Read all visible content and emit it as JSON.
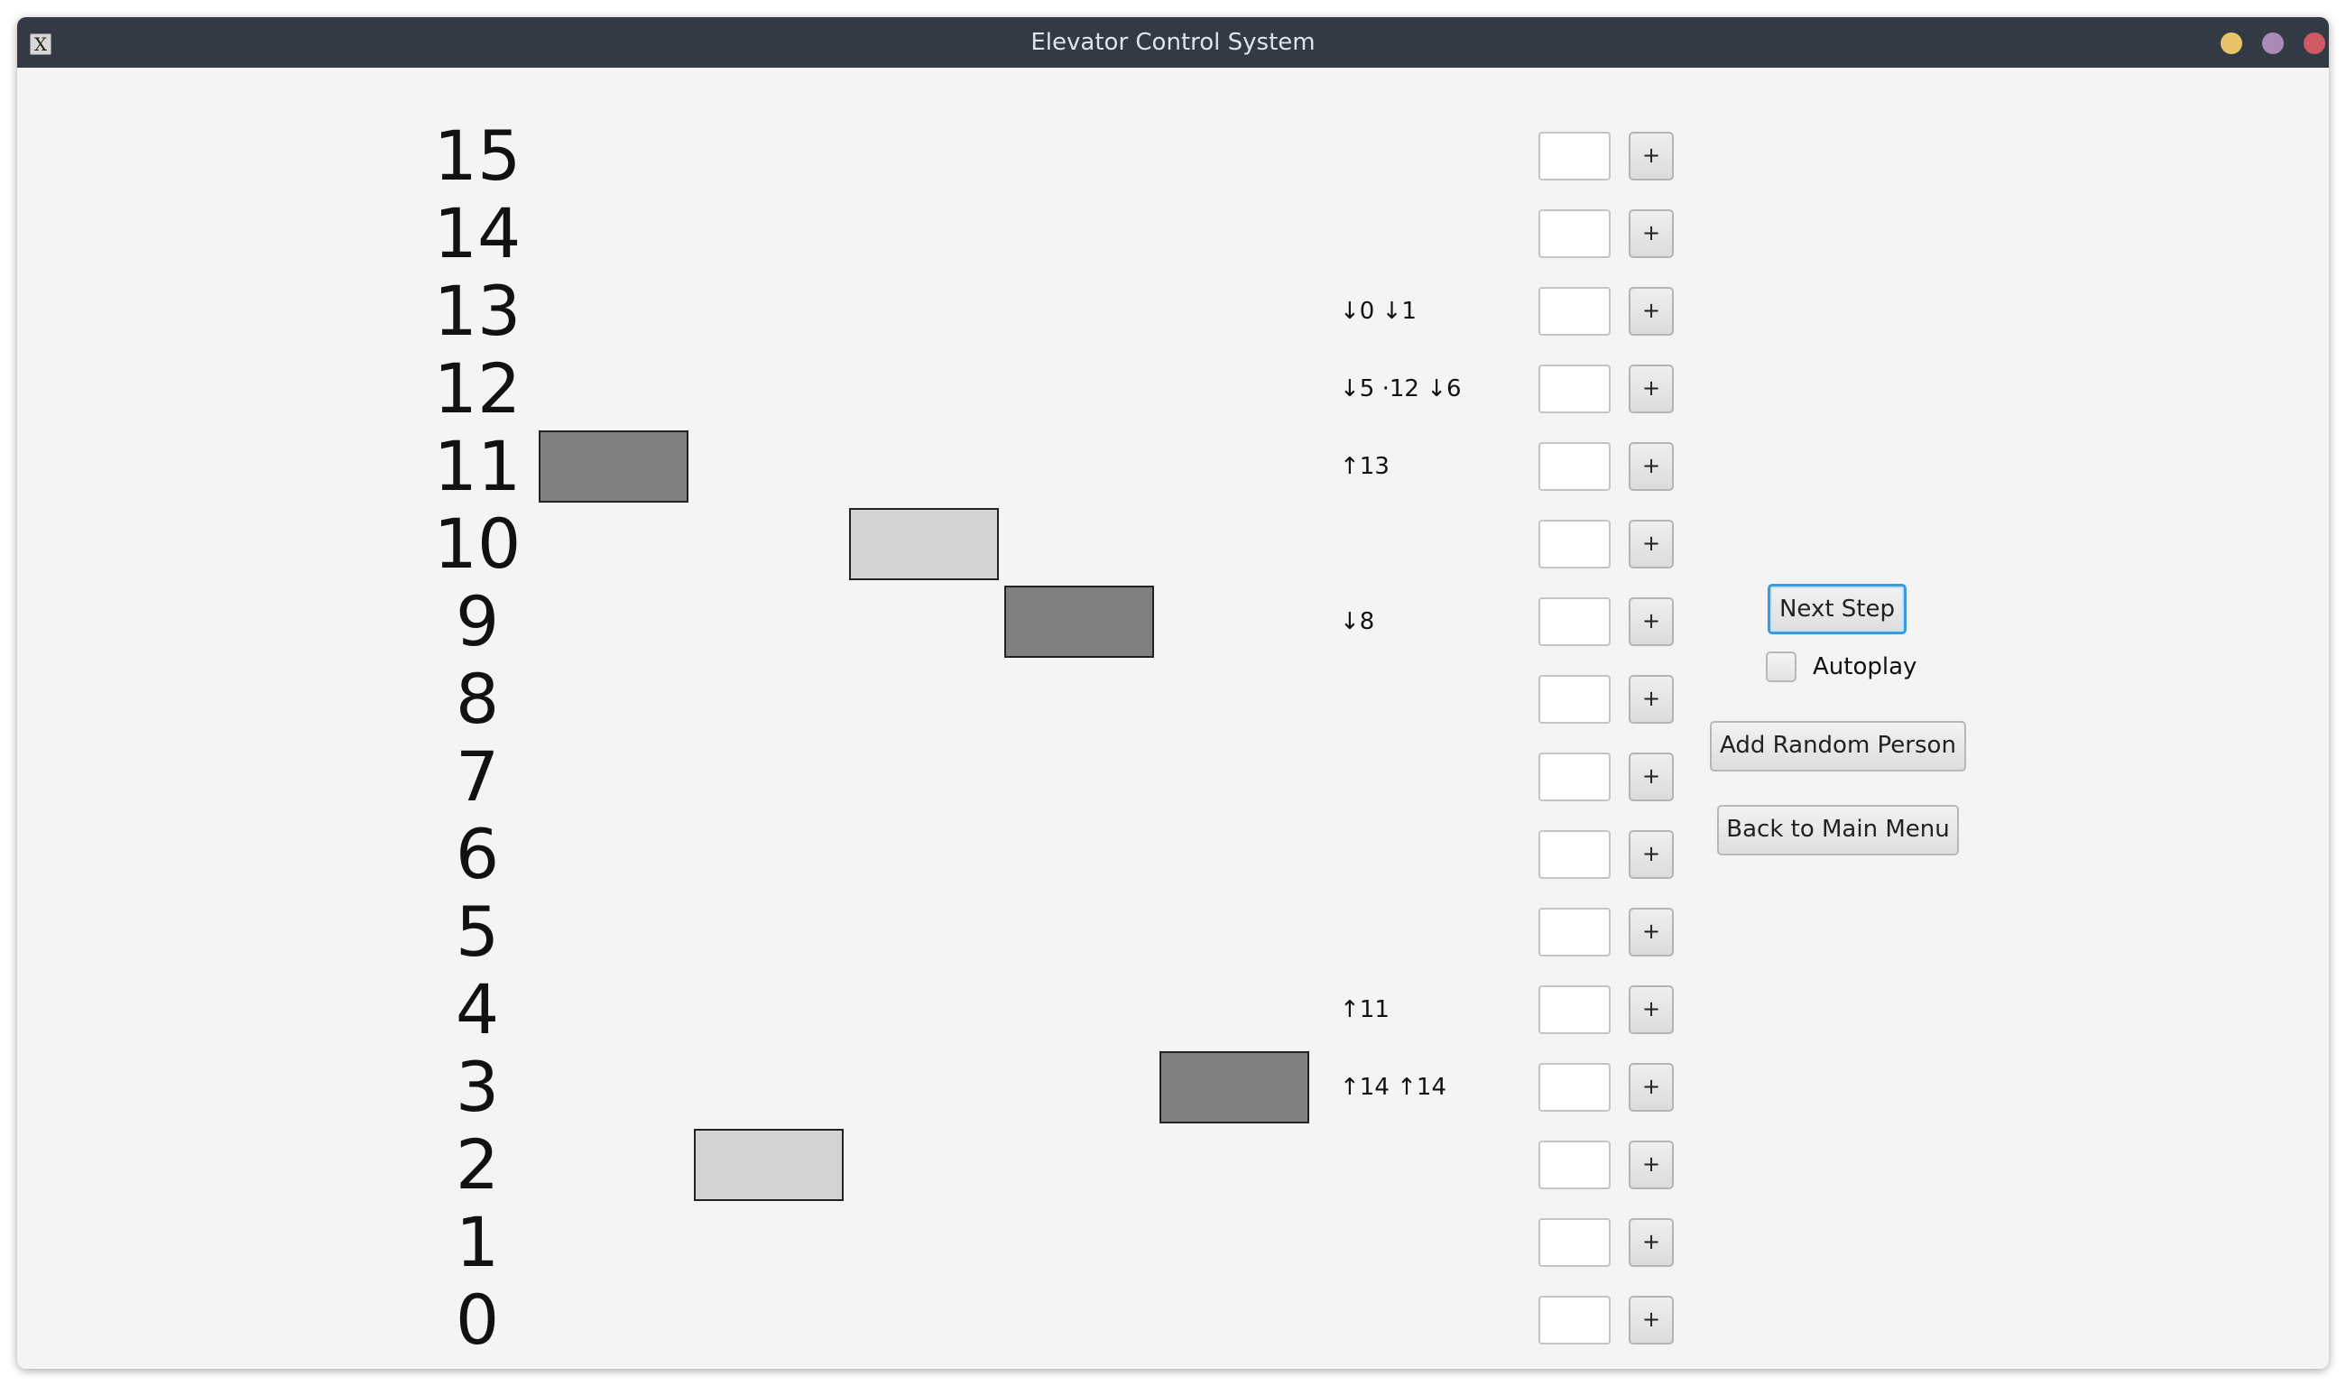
{
  "window": {
    "title": "Elevator Control System",
    "app_icon": "X"
  },
  "floors": [
    {
      "number": "15",
      "queue": "",
      "add_label": "+"
    },
    {
      "number": "14",
      "queue": "",
      "add_label": "+"
    },
    {
      "number": "13",
      "queue": "↓0 ↓1",
      "add_label": "+"
    },
    {
      "number": "12",
      "queue": "↓5 ·12 ↓6",
      "add_label": "+"
    },
    {
      "number": "11",
      "queue": "↑13",
      "add_label": "+"
    },
    {
      "number": "10",
      "queue": "",
      "add_label": "+"
    },
    {
      "number": "9",
      "queue": "↓8",
      "add_label": "+"
    },
    {
      "number": "8",
      "queue": "",
      "add_label": "+"
    },
    {
      "number": "7",
      "queue": "",
      "add_label": "+"
    },
    {
      "number": "6",
      "queue": "",
      "add_label": "+"
    },
    {
      "number": "5",
      "queue": "",
      "add_label": "+"
    },
    {
      "number": "4",
      "queue": "↑11",
      "add_label": "+"
    },
    {
      "number": "3",
      "queue": "↑14 ↑14",
      "add_label": "+"
    },
    {
      "number": "2",
      "queue": "",
      "add_label": "+"
    },
    {
      "number": "1",
      "queue": "",
      "add_label": "+"
    },
    {
      "number": "0",
      "queue": "",
      "add_label": "+"
    }
  ],
  "elevators": [
    {
      "id": 1,
      "floor": 11,
      "state": "dark"
    },
    {
      "id": 2,
      "floor": 2,
      "state": "light"
    },
    {
      "id": 3,
      "floor": 10,
      "state": "light"
    },
    {
      "id": 4,
      "floor": 9,
      "state": "dark"
    },
    {
      "id": 5,
      "floor": 3,
      "state": "dark"
    }
  ],
  "controls": {
    "next_step": "Next Step",
    "autoplay": "Autoplay",
    "autoplay_checked": false,
    "add_random": "Add Random Person",
    "back_menu": "Back to Main Menu"
  },
  "colors": {
    "titlebar": "#333a46",
    "background": "#f4f4f4",
    "car_dark": "#808080",
    "car_light": "#d3d3d3",
    "focus": "#3a9ae0",
    "min_button": "#e8c36a",
    "max_button": "#a98bb5",
    "close_button": "#d05a61"
  }
}
